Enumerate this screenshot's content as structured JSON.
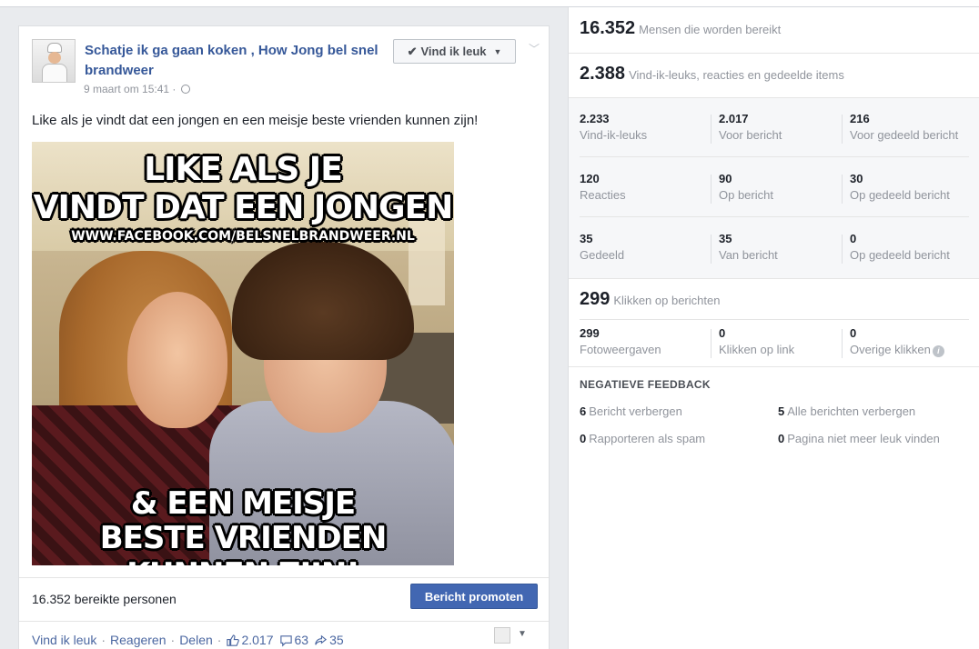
{
  "post": {
    "page_name": "Schatje ik ga gaan koken , How Jong bel snel brandweer",
    "timestamp": "9 maart om 15:41 ·",
    "like_page_button": "Vind ik leuk",
    "text": "Like als je vindt dat een jongen en een meisje beste vrienden kunnen zijn!",
    "image": {
      "line1": "LIKE ALS JE",
      "line2": "VINDT DAT EEN JONGEN",
      "url": "WWW.FACEBOOK.COM/BELSNELBRANDWEER.NL",
      "line3": "& EEN MEISJE",
      "line4": "BESTE VRIENDEN KUNNEN ZIJN!"
    },
    "reach_text": "16.352 bereikte personen",
    "promote_button": "Bericht promoten",
    "actions": {
      "like": "Vind ik leuk",
      "comment": "Reageren",
      "share": "Delen",
      "like_count": "2.017",
      "comment_count": "63",
      "share_count": "35"
    }
  },
  "stats": {
    "reached": {
      "value": "16.352",
      "label": "Mensen die worden bereikt"
    },
    "engagement": {
      "value": "2.388",
      "label": "Vind-ik-leuks, reacties en gedeelde items"
    },
    "likes": [
      {
        "value": "2.233",
        "label": "Vind-ik-leuks"
      },
      {
        "value": "2.017",
        "label": "Voor bericht"
      },
      {
        "value": "216",
        "label": "Voor gedeeld bericht"
      }
    ],
    "comments": [
      {
        "value": "120",
        "label": "Reacties"
      },
      {
        "value": "90",
        "label": "Op bericht"
      },
      {
        "value": "30",
        "label": "Op gedeeld bericht"
      }
    ],
    "shares": [
      {
        "value": "35",
        "label": "Gedeeld"
      },
      {
        "value": "35",
        "label": "Van bericht"
      },
      {
        "value": "0",
        "label": "Op gedeeld bericht"
      }
    ],
    "clicks": {
      "value": "299",
      "label": "Klikken op berichten"
    },
    "click_breakdown": [
      {
        "value": "299",
        "label": "Fotoweergaven"
      },
      {
        "value": "0",
        "label": "Klikken op link"
      },
      {
        "value": "0",
        "label": "Overige klikken"
      }
    ],
    "negative_feedback": {
      "title": "NEGATIEVE FEEDBACK",
      "items": [
        {
          "value": "6",
          "label": "Bericht verbergen"
        },
        {
          "value": "5",
          "label": "Alle berichten verbergen"
        },
        {
          "value": "0",
          "label": "Rapporteren als spam"
        },
        {
          "value": "0",
          "label": "Pagina niet meer leuk vinden"
        }
      ]
    }
  },
  "colors": {
    "link": "#365899",
    "button": "#4267b2",
    "muted": "#90949c"
  }
}
